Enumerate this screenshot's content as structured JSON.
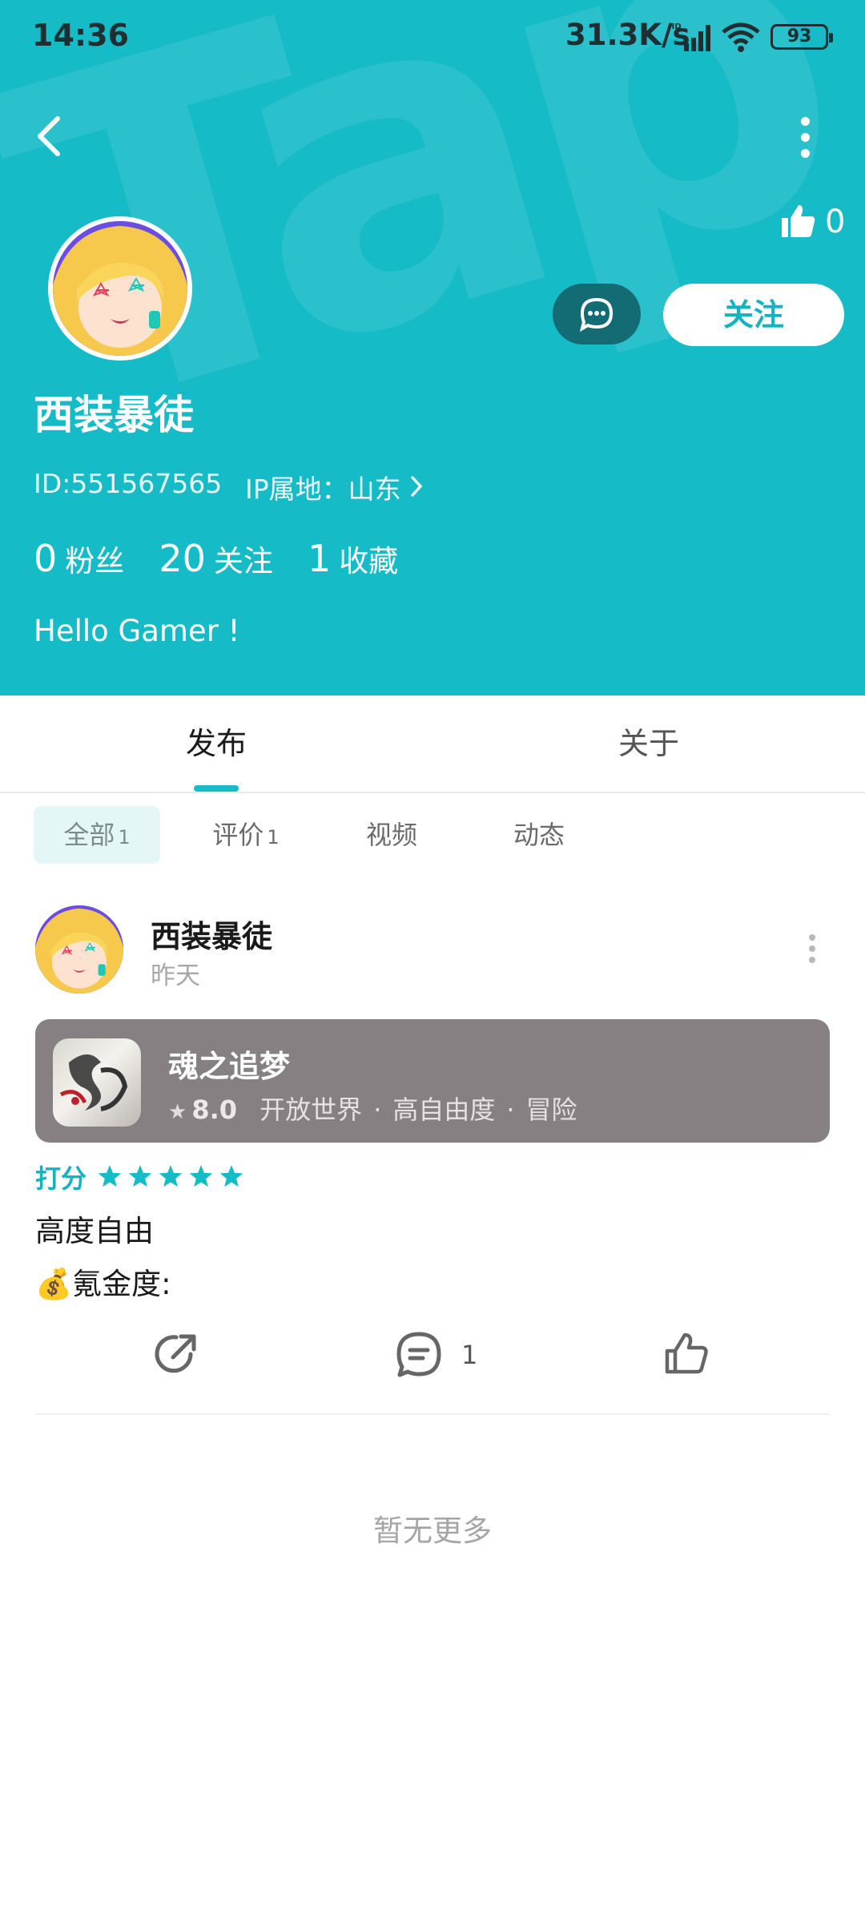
{
  "status_bar": {
    "time": "14:36",
    "net_speed": "31.3K/s",
    "battery": "93"
  },
  "header": {
    "like_count": "0",
    "follow_label": "关注",
    "username": "西装暴徒",
    "user_id": "ID:551567565",
    "ip_location": "IP属地：山东",
    "stats": [
      {
        "num": "0",
        "label": "粉丝"
      },
      {
        "num": "20",
        "label": "关注"
      },
      {
        "num": "1",
        "label": "收藏"
      }
    ],
    "bio": "Hello Gamer !",
    "background_color": "#15bbc7",
    "watermark_text": "TapTap"
  },
  "tabs": {
    "main": [
      "发布",
      "关于"
    ],
    "active_main": "发布",
    "sub": [
      {
        "label": "全部",
        "count": "1"
      },
      {
        "label": "评价",
        "count": "1"
      },
      {
        "label": "视频",
        "count": ""
      },
      {
        "label": "动态",
        "count": ""
      }
    ],
    "active_sub": "全部"
  },
  "post": {
    "author": "西装暴徒",
    "time": "昨天",
    "game": {
      "title": "魂之追梦",
      "rating": "8.0",
      "tags": [
        "开放世界",
        "高自由度",
        "冒险"
      ]
    },
    "score_label": "打分",
    "score_stars": 5,
    "text_line1": "高度自由",
    "text_line2": "💰氪金度:",
    "comment_count": "1"
  },
  "footer_text": "暂无更多",
  "colors": {
    "accent": "#15bbc7",
    "game_card": "#878083"
  }
}
